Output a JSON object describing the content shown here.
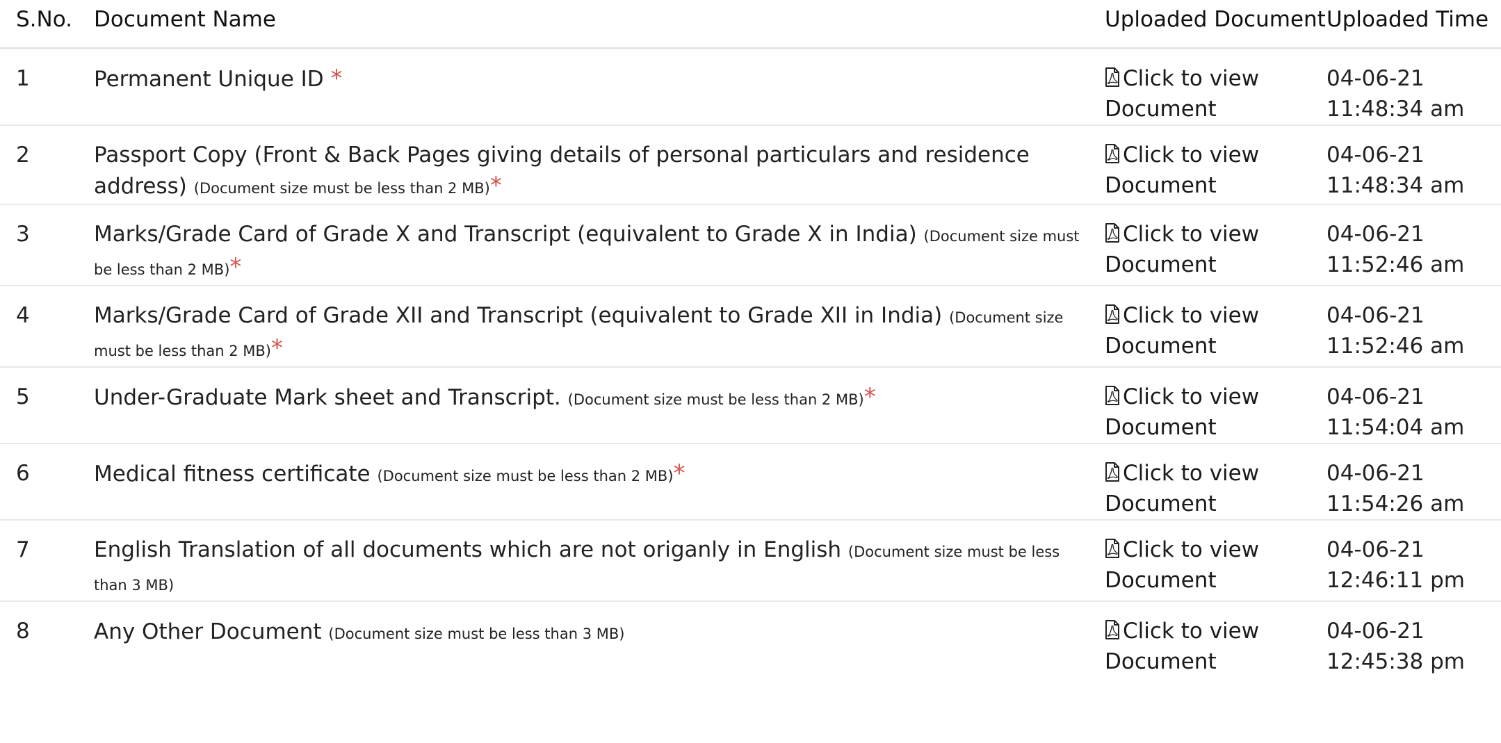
{
  "table": {
    "headers": {
      "sno": "S.No.",
      "name": "Document Name",
      "uploaded": "Uploaded Document",
      "time": "Uploaded Time"
    },
    "rows": [
      {
        "sno": "1",
        "name": "Permanent Unique ID ",
        "note": "",
        "required": "*",
        "link": "Click to view Document",
        "date": "04-06-21",
        "time": "11:48:34 am"
      },
      {
        "sno": "2",
        "name": "Passport Copy (Front & Back Pages giving details of personal particulars and residence address) ",
        "note": "(Document size must be less than 2 MB)",
        "required": "*",
        "link": "Click to view Document",
        "date": "04-06-21",
        "time": "11:48:34 am"
      },
      {
        "sno": "3",
        "name": "Marks/Grade Card of Grade X and Transcript (equivalent to Grade X in India) ",
        "note": "(Document size must be less than 2 MB)",
        "required": "*",
        "link": "Click to view Document",
        "date": "04-06-21",
        "time": "11:52:46 am"
      },
      {
        "sno": "4",
        "name": "Marks/Grade Card of Grade XII and Transcript (equivalent to Grade XII in India) ",
        "note": "(Document size must be less than 2 MB)",
        "required": "*",
        "link": "Click to view Document",
        "date": "04-06-21",
        "time": "11:52:46 am"
      },
      {
        "sno": "5",
        "name": "Under-Graduate Mark sheet and Transcript. ",
        "note": "(Document size must be less than 2 MB)",
        "required": "*",
        "link": "Click to view Document",
        "date": "04-06-21",
        "time": "11:54:04 am"
      },
      {
        "sno": "6",
        "name": "Medical fitness certificate ",
        "note": "(Document size must be less than 2 MB)",
        "required": "*",
        "link": "Click to view Document",
        "date": "04-06-21",
        "time": "11:54:26 am"
      },
      {
        "sno": "7",
        "name": "English Translation of all documents which are not origanly in English ",
        "note": "(Document size must be less than 3 MB)",
        "required": "",
        "link": "Click to view Document",
        "date": "04-06-21",
        "time": "12:46:11 pm"
      },
      {
        "sno": "8",
        "name": "Any Other Document ",
        "note": "(Document size must be less than 3 MB)",
        "required": "",
        "link": "Click to view Document",
        "date": "04-06-21",
        "time": "12:45:38 pm"
      }
    ]
  },
  "colors": {
    "required_asterisk": "#d9534f",
    "row_divider": "#e9e9e9"
  },
  "icons": {
    "view_link": "pdf-file-icon"
  }
}
